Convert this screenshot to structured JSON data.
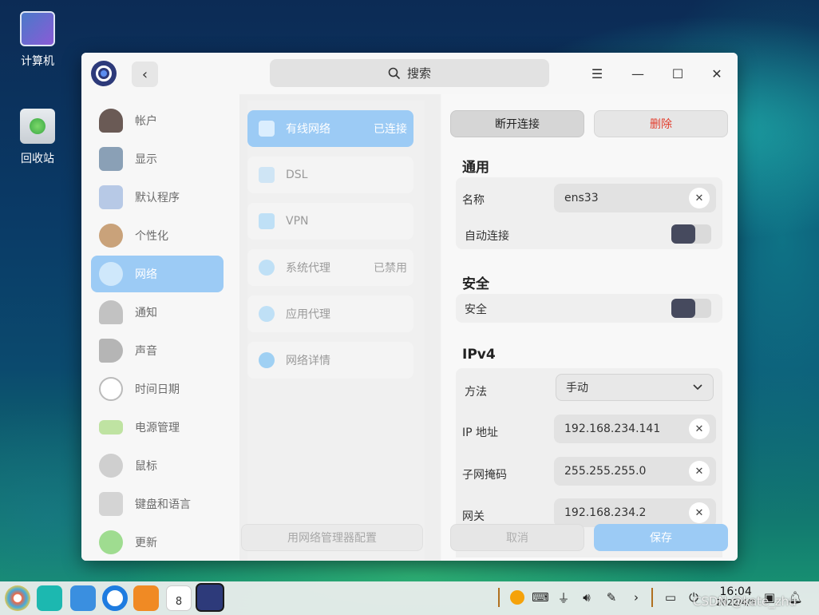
{
  "desktop": {
    "icons": [
      {
        "label": "计算机",
        "icon": "computer-icon"
      },
      {
        "label": "回收站",
        "icon": "trash-icon"
      }
    ]
  },
  "window": {
    "search": {
      "label": "搜索",
      "icon": "search-icon"
    },
    "controls": {
      "menu": "☰",
      "minimize": "—",
      "maximize": "☐",
      "close": "✕"
    },
    "back": "‹"
  },
  "sidebar": {
    "items": [
      {
        "label": "帐户",
        "icon": "account-icon",
        "color": "#6a5a55"
      },
      {
        "label": "显示",
        "icon": "display-icon",
        "color": "#8aa0b6"
      },
      {
        "label": "默认程序",
        "icon": "default-apps-icon",
        "color": "#b7c9e6"
      },
      {
        "label": "个性化",
        "icon": "palette-icon",
        "color": "#c9a27a"
      },
      {
        "label": "网络",
        "icon": "network-icon",
        "color": "#cfe8fb"
      },
      {
        "label": "通知",
        "icon": "bell-icon",
        "color": "#c2c2c2"
      },
      {
        "label": "声音",
        "icon": "speaker-icon",
        "color": "#b5b5b5"
      },
      {
        "label": "时间日期",
        "icon": "clock-icon",
        "color": "#e4e4e4"
      },
      {
        "label": "电源管理",
        "icon": "battery-icon",
        "color": "#bfe3a2"
      },
      {
        "label": "鼠标",
        "icon": "mouse-icon",
        "color": "#cfcfcf"
      },
      {
        "label": "键盘和语言",
        "icon": "keyboard-icon",
        "color": "#d4d4d4"
      },
      {
        "label": "更新",
        "icon": "update-icon",
        "color": "#9fdc90"
      }
    ],
    "active": "网络"
  },
  "network_menu": {
    "items": [
      {
        "label": "有线网络",
        "status": "已连接",
        "icon": "wired-icon"
      },
      {
        "label": "DSL",
        "status": "",
        "icon": "dsl-icon"
      },
      {
        "label": "VPN",
        "status": "",
        "icon": "vpn-icon"
      },
      {
        "label": "系统代理",
        "status": "已禁用",
        "icon": "proxy-icon"
      },
      {
        "label": "应用代理",
        "status": "",
        "icon": "app-proxy-icon"
      },
      {
        "label": "网络详情",
        "status": "",
        "icon": "info-icon"
      }
    ],
    "manager_button": "用网络管理器配置"
  },
  "detail": {
    "disconnect_button": "断开连接",
    "delete_button": "删除",
    "general": {
      "title": "通用",
      "name_label": "名称",
      "name_value": "ens33",
      "autoconnect_label": "自动连接",
      "autoconnect_on": false
    },
    "security": {
      "title": "安全",
      "label": "安全",
      "enabled": false
    },
    "ipv4": {
      "title": "IPv4",
      "method_label": "方法",
      "method_value": "手动",
      "ip_label": "IP 地址",
      "ip_value": "192.168.234.141",
      "mask_label": "子网掩码",
      "mask_value": "255.255.255.0",
      "gateway_label": "网关",
      "gateway_value": "192.168.234.2"
    },
    "cancel_button": "取消",
    "save_button": "保存"
  },
  "taskbar": {
    "time": "16:04",
    "date": "2022/4/8",
    "calendar_day": "8",
    "tray_icons": [
      "input-method-icon",
      "keyboard-icon",
      "usb-icon",
      "volume-icon",
      "pen-icon",
      "chevron-right-icon",
      "keyboard-layout-icon",
      "power-icon"
    ]
  },
  "watermark": "CSDN @kate_zhu"
}
